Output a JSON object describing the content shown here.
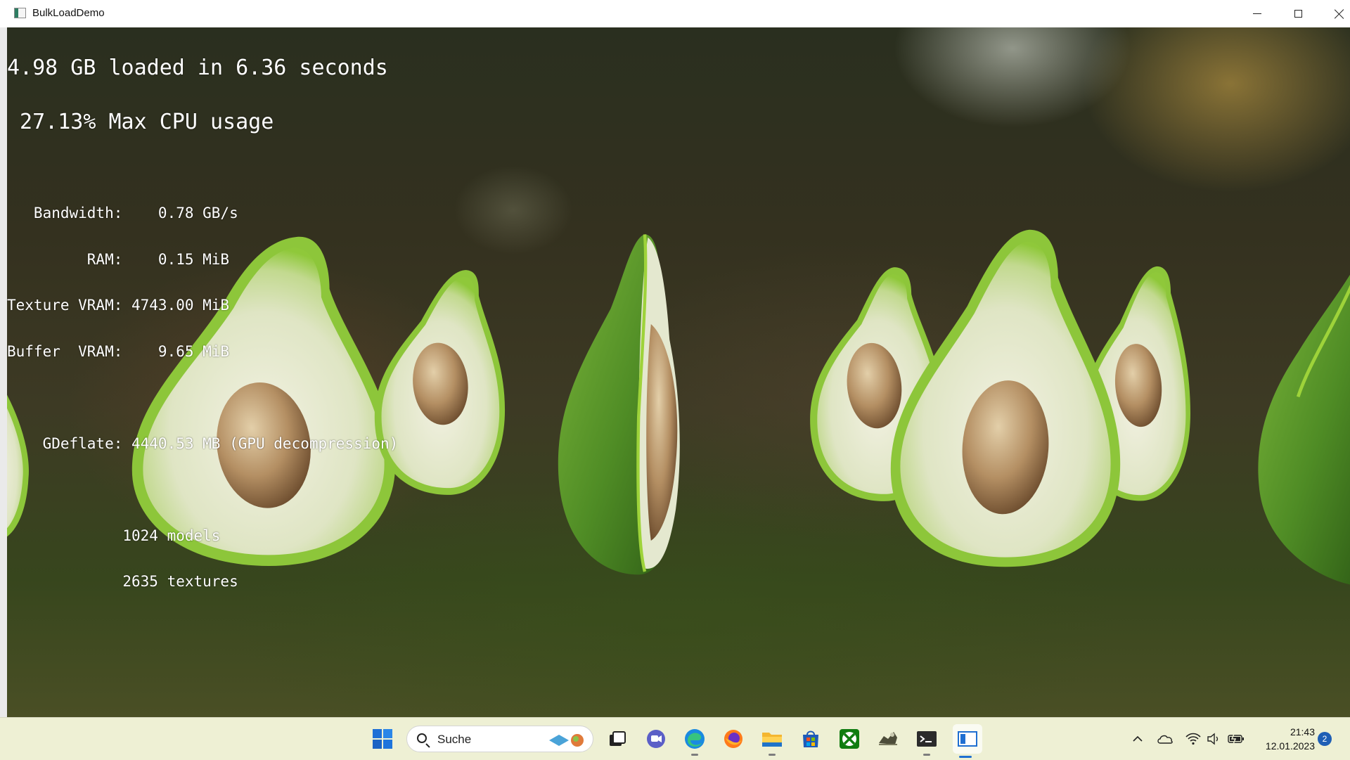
{
  "window": {
    "title": "BulkLoadDemo",
    "controls": {
      "minimize": "minimize",
      "maximize": "maximize",
      "close": "close"
    }
  },
  "stats": {
    "headline": "4.98 GB loaded in 6.36 seconds",
    "cpu": " 27.13% Max CPU usage",
    "lines": [
      "   Bandwidth:    0.78 GB/s",
      "         RAM:    0.15 MiB",
      "Texture VRAM: 4743.00 MiB",
      "Buffer  VRAM:    9.65 MiB",
      "",
      "    GDeflate: 4440.53 MB (GPU decompression)",
      "",
      "             1024 models",
      "             2635 textures"
    ]
  },
  "scene": {
    "objects": [
      "avocado-half",
      "avocado-half",
      "avocado-half",
      "avocado-side",
      "avocado-half",
      "avocado-half",
      "avocado-half",
      "avocado-partial",
      "avocado-partial"
    ],
    "colors": {
      "skin": "#5a9a2a",
      "rim": "#9ed33a",
      "flesh": "#e6ead0",
      "pit": "#b89a6e"
    }
  },
  "taskbar": {
    "search": {
      "placeholder": "Suche"
    },
    "pinned": [
      "start-icon",
      "search",
      "task-view-icon",
      "teams-chat-icon",
      "edge-icon",
      "firefox-icon",
      "file-explorer-icon",
      "store-icon",
      "xbox-icon",
      "game-icon",
      "terminal-icon",
      "bulkloaddemo-icon"
    ],
    "tray": [
      "chevron-up-icon",
      "onedrive-icon",
      "wifi-icon",
      "volume-icon",
      "battery-icon"
    ],
    "clock": {
      "time": "21:43",
      "date": "12.01.2023"
    },
    "notifications": "2"
  }
}
